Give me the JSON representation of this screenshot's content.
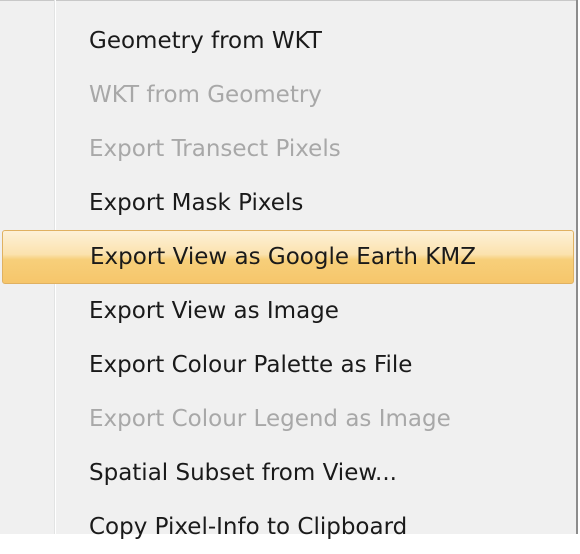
{
  "menu": {
    "items": [
      {
        "label": "Geometry from WKT",
        "enabled": true,
        "highlighted": false
      },
      {
        "label": "WKT from Geometry",
        "enabled": false,
        "highlighted": false
      },
      {
        "label": "Export Transect Pixels",
        "enabled": false,
        "highlighted": false
      },
      {
        "label": "Export Mask Pixels",
        "enabled": true,
        "highlighted": false
      },
      {
        "label": "Export View as Google Earth KMZ",
        "enabled": true,
        "highlighted": true
      },
      {
        "label": "Export View as Image",
        "enabled": true,
        "highlighted": false
      },
      {
        "label": "Export Colour Palette as File",
        "enabled": true,
        "highlighted": false
      },
      {
        "label": "Export Colour Legend as Image",
        "enabled": false,
        "highlighted": false
      },
      {
        "label": "Spatial Subset from View...",
        "enabled": true,
        "highlighted": false
      },
      {
        "label": "Copy Pixel-Info to Clipboard",
        "enabled": true,
        "highlighted": false
      }
    ]
  },
  "colors": {
    "menu_background": "#f0f0f0",
    "enabled_text": "#1a1a1a",
    "disabled_text": "#a8a8a8",
    "highlight_top": "#fdf1d8",
    "highlight_bottom": "#f6c66b",
    "highlight_border": "#e0b161"
  }
}
